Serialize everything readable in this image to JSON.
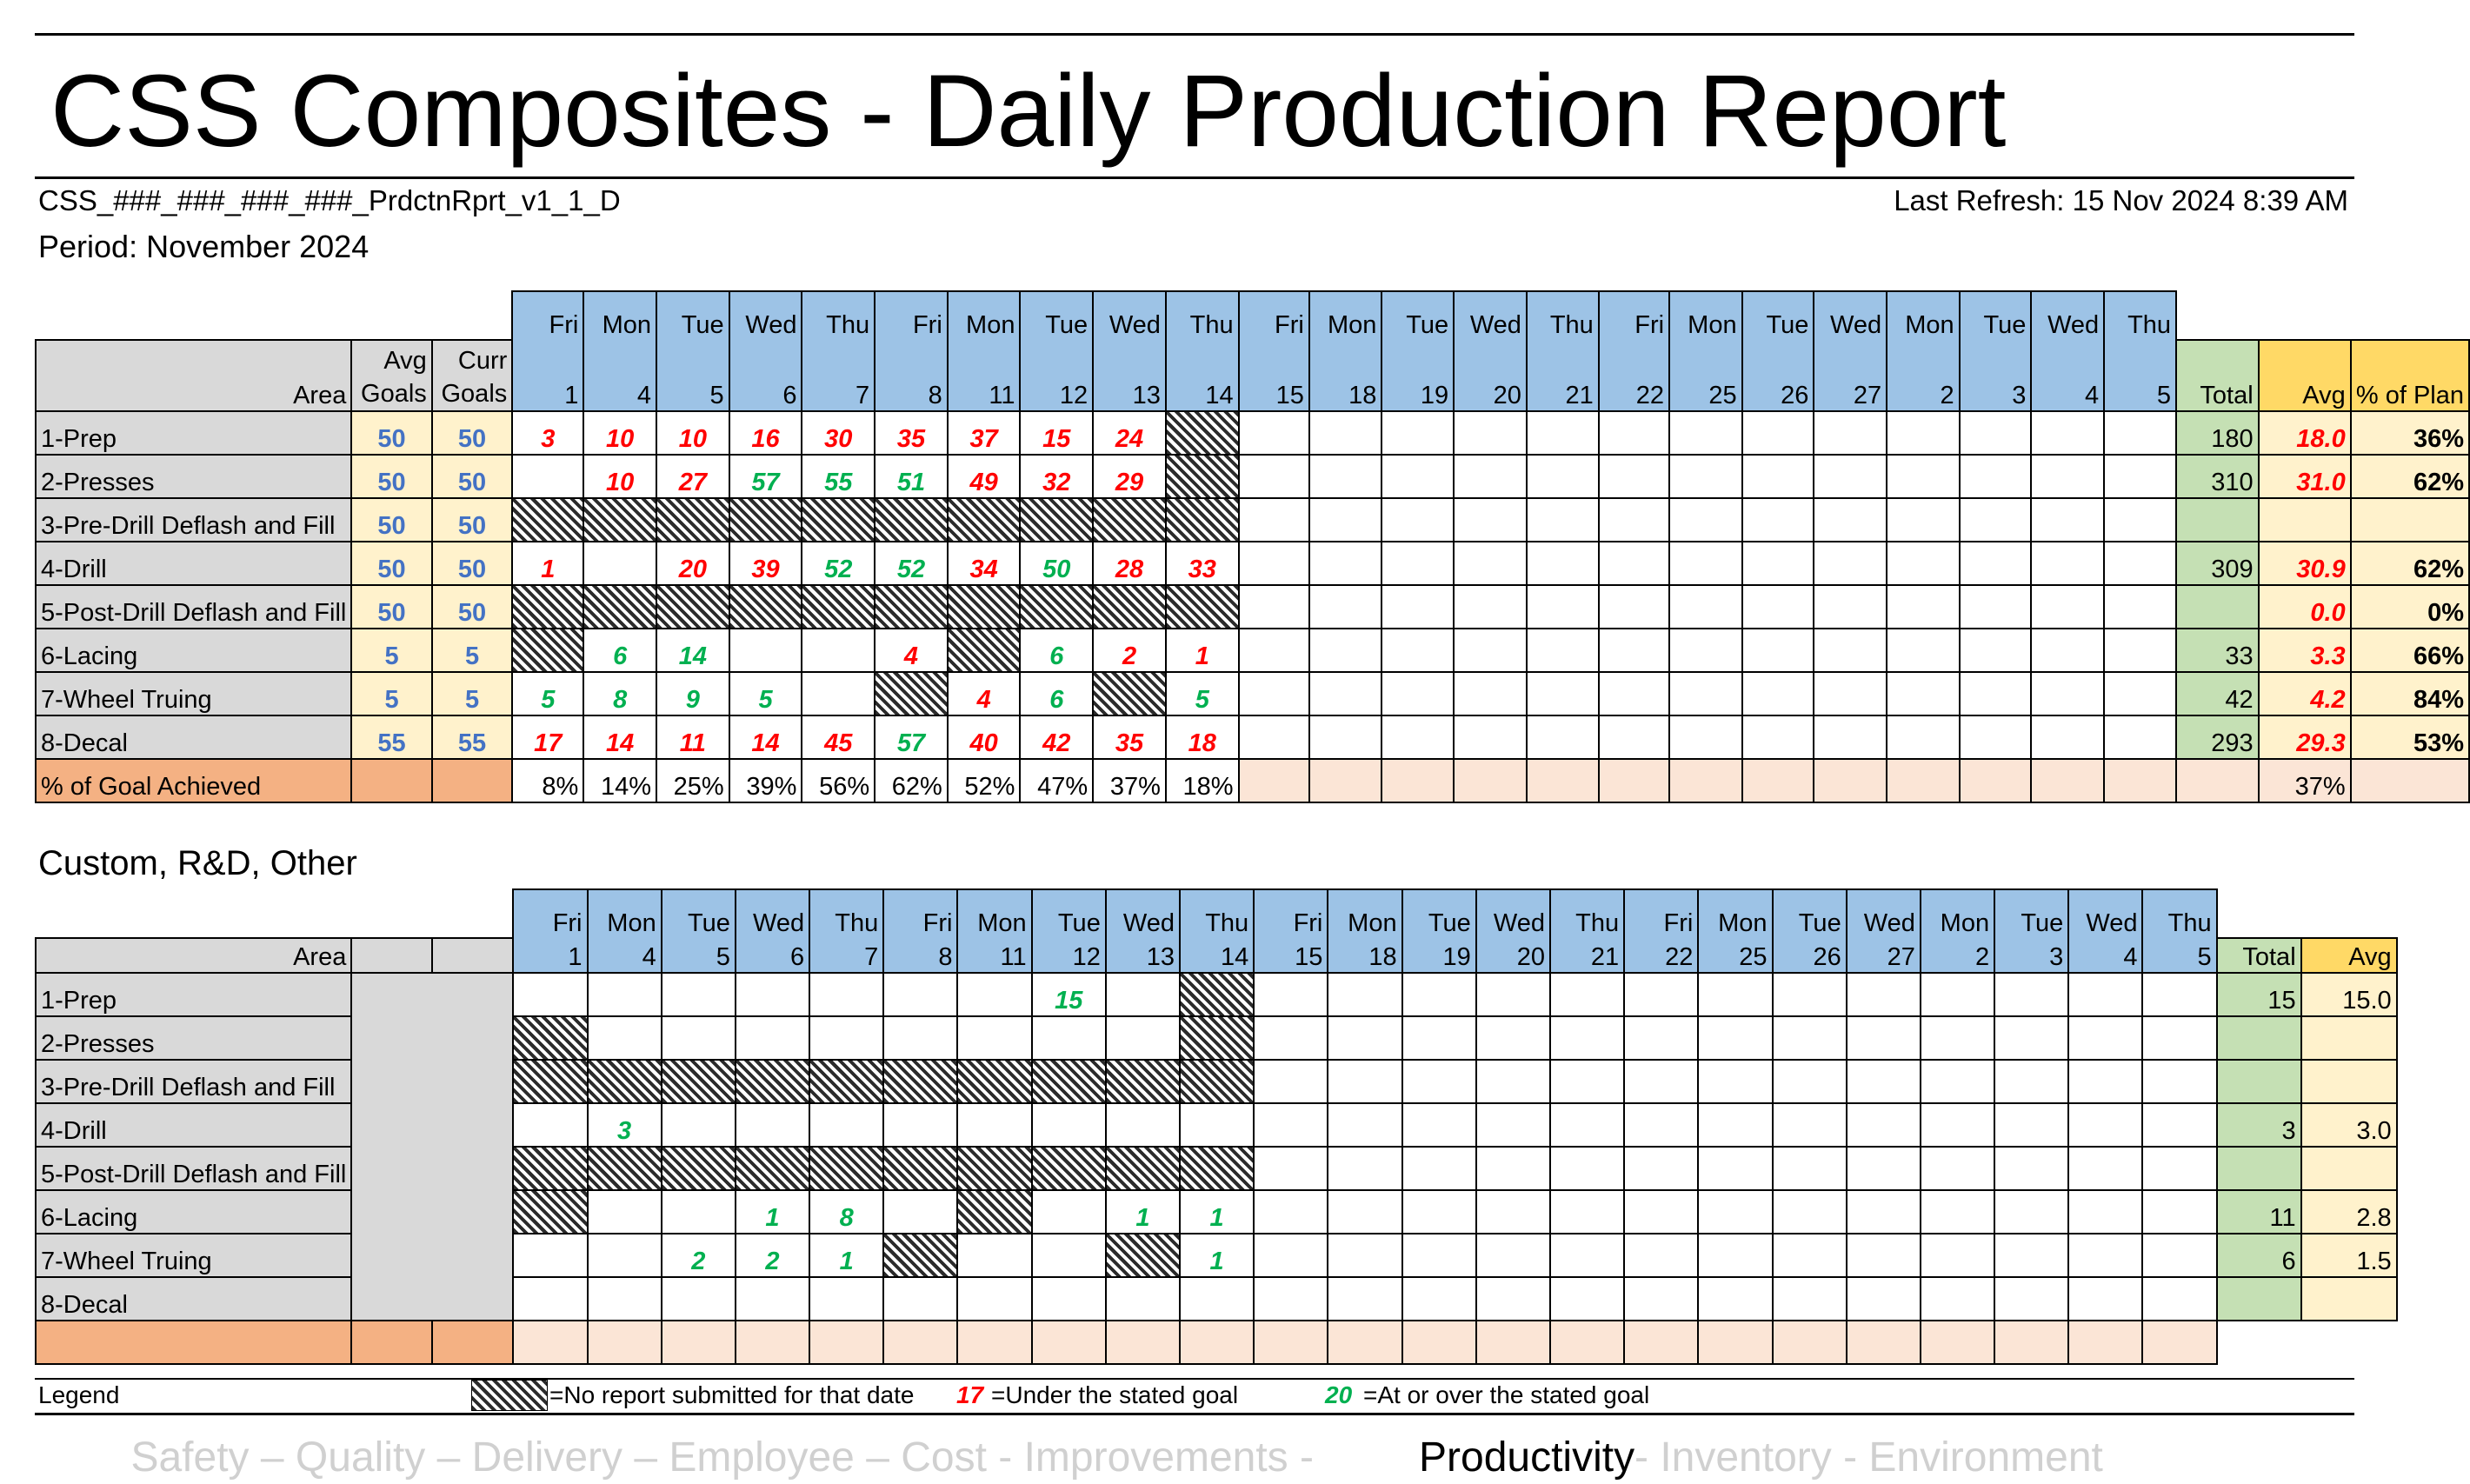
{
  "title": "CSS Composites - Daily Production Report",
  "file_name": "CSS_###_###_###_###_PrdctnRprt_v1_1_D",
  "last_refresh": "Last Refresh: 15 Nov 2024 8:39 AM",
  "period": "Period: November 2024",
  "days": [
    "Fri",
    "Mon",
    "Tue",
    "Wed",
    "Thu",
    "Fri",
    "Mon",
    "Tue",
    "Wed",
    "Thu",
    "Fri",
    "Mon",
    "Tue",
    "Wed",
    "Thu",
    "Fri",
    "Mon",
    "Tue",
    "Wed",
    "Mon",
    "Tue",
    "Wed",
    "Thu"
  ],
  "dates": [
    "1",
    "4",
    "5",
    "6",
    "7",
    "8",
    "11",
    "12",
    "13",
    "14",
    "15",
    "18",
    "19",
    "20",
    "21",
    "22",
    "25",
    "26",
    "27",
    "2",
    "3",
    "4",
    "5"
  ],
  "headers": {
    "area": "Area",
    "avg_goals": [
      "Avg",
      "Goals"
    ],
    "curr_goals": [
      "Curr",
      "Goals"
    ],
    "total": "Total",
    "avg": "Avg",
    "pct_plan": "% of Plan"
  },
  "colors": {
    "under_goal": "#ff0000",
    "at_goal": "#00b050",
    "goal_text": "#4472c4"
  },
  "main": {
    "rows": [
      {
        "area": "1-Prep",
        "avg_goal": "50",
        "curr_goal": "50",
        "cells": [
          [
            "3",
            "r"
          ],
          [
            "10",
            "r"
          ],
          [
            "10",
            "r"
          ],
          [
            "16",
            "r"
          ],
          [
            "30",
            "r"
          ],
          [
            "35",
            "r"
          ],
          [
            "37",
            "r"
          ],
          [
            "15",
            "r"
          ],
          [
            "24",
            "r"
          ],
          [
            "",
            "h"
          ]
        ],
        "total": "180",
        "avg": "18.0",
        "pct": "36%"
      },
      {
        "area": "2-Presses",
        "avg_goal": "50",
        "curr_goal": "50",
        "cells": [
          [
            "",
            ""
          ],
          [
            "10",
            "r"
          ],
          [
            "27",
            "r"
          ],
          [
            "57",
            "g"
          ],
          [
            "55",
            "g"
          ],
          [
            "51",
            "g"
          ],
          [
            "49",
            "r"
          ],
          [
            "32",
            "r"
          ],
          [
            "29",
            "r"
          ],
          [
            "",
            "h"
          ]
        ],
        "total": "310",
        "avg": "31.0",
        "pct": "62%"
      },
      {
        "area": "3-Pre-Drill Deflash and Fill",
        "avg_goal": "50",
        "curr_goal": "50",
        "cells": [
          [
            "",
            "h"
          ],
          [
            "",
            "h"
          ],
          [
            "",
            "h"
          ],
          [
            "",
            "h"
          ],
          [
            "",
            "h"
          ],
          [
            "",
            "h"
          ],
          [
            "",
            "h"
          ],
          [
            "",
            "h"
          ],
          [
            "",
            "h"
          ],
          [
            "",
            "h"
          ]
        ],
        "total": "",
        "avg": "",
        "pct": ""
      },
      {
        "area": "4-Drill",
        "avg_goal": "50",
        "curr_goal": "50",
        "cells": [
          [
            "1",
            "r"
          ],
          [
            "",
            ""
          ],
          [
            "20",
            "r"
          ],
          [
            "39",
            "r"
          ],
          [
            "52",
            "g"
          ],
          [
            "52",
            "g"
          ],
          [
            "34",
            "r"
          ],
          [
            "50",
            "g"
          ],
          [
            "28",
            "r"
          ],
          [
            "33",
            "r"
          ]
        ],
        "total": "309",
        "avg": "30.9",
        "pct": "62%"
      },
      {
        "area": "5-Post-Drill Deflash and Fill",
        "avg_goal": "50",
        "curr_goal": "50",
        "cells": [
          [
            "",
            "h"
          ],
          [
            "",
            "h"
          ],
          [
            "",
            "h"
          ],
          [
            "",
            "h"
          ],
          [
            "",
            "h"
          ],
          [
            "",
            "h"
          ],
          [
            "",
            "h"
          ],
          [
            "",
            "h"
          ],
          [
            "",
            "h"
          ],
          [
            "",
            "h"
          ]
        ],
        "total": "",
        "avg": "0.0",
        "pct": "0%"
      },
      {
        "area": "6-Lacing",
        "avg_goal": "5",
        "curr_goal": "5",
        "cells": [
          [
            "",
            "h"
          ],
          [
            "6",
            "g"
          ],
          [
            "14",
            "g"
          ],
          [
            "",
            ""
          ],
          [
            "",
            ""
          ],
          [
            "4",
            "r"
          ],
          [
            "",
            "h"
          ],
          [
            "6",
            "g"
          ],
          [
            "2",
            "r"
          ],
          [
            "1",
            "r"
          ]
        ],
        "total": "33",
        "avg": "3.3",
        "pct": "66%"
      },
      {
        "area": "7-Wheel Truing",
        "avg_goal": "5",
        "curr_goal": "5",
        "cells": [
          [
            "5",
            "g"
          ],
          [
            "8",
            "g"
          ],
          [
            "9",
            "g"
          ],
          [
            "5",
            "g"
          ],
          [
            "",
            ""
          ],
          [
            "",
            "h"
          ],
          [
            "4",
            "r"
          ],
          [
            "6",
            "g"
          ],
          [
            "",
            "h"
          ],
          [
            "5",
            "g"
          ]
        ],
        "total": "42",
        "avg": "4.2",
        "pct": "84%"
      },
      {
        "area": "8-Decal",
        "avg_goal": "55",
        "curr_goal": "55",
        "cells": [
          [
            "17",
            "r"
          ],
          [
            "14",
            "r"
          ],
          [
            "11",
            "r"
          ],
          [
            "14",
            "r"
          ],
          [
            "45",
            "r"
          ],
          [
            "57",
            "g"
          ],
          [
            "40",
            "r"
          ],
          [
            "42",
            "r"
          ],
          [
            "35",
            "r"
          ],
          [
            "18",
            "r"
          ]
        ],
        "total": "293",
        "avg": "29.3",
        "pct": "53%"
      }
    ],
    "goal_row": {
      "label": "% of Goal Achieved",
      "values": [
        "8%",
        "14%",
        "25%",
        "39%",
        "56%",
        "62%",
        "52%",
        "47%",
        "37%",
        "18%"
      ],
      "avg": "37%"
    }
  },
  "custom": {
    "title": "Custom, R&D, Other",
    "rows": [
      {
        "area": "1-Prep",
        "cells": [
          [
            "",
            ""
          ],
          [
            "",
            ""
          ],
          [
            "",
            ""
          ],
          [
            "",
            ""
          ],
          [
            "",
            ""
          ],
          [
            "",
            ""
          ],
          [
            "",
            ""
          ],
          [
            "15",
            "g"
          ],
          [
            "",
            ""
          ],
          [
            "",
            "h"
          ]
        ],
        "total": "15",
        "avg": "15.0"
      },
      {
        "area": "2-Presses",
        "cells": [
          [
            "",
            "h"
          ],
          [
            "",
            ""
          ],
          [
            "",
            ""
          ],
          [
            "",
            ""
          ],
          [
            "",
            ""
          ],
          [
            "",
            ""
          ],
          [
            "",
            ""
          ],
          [
            "",
            ""
          ],
          [
            "",
            ""
          ],
          [
            "",
            "h"
          ]
        ],
        "total": "",
        "avg": ""
      },
      {
        "area": "3-Pre-Drill Deflash and Fill",
        "cells": [
          [
            "",
            "h"
          ],
          [
            "",
            "h"
          ],
          [
            "",
            "h"
          ],
          [
            "",
            "h"
          ],
          [
            "",
            "h"
          ],
          [
            "",
            "h"
          ],
          [
            "",
            "h"
          ],
          [
            "",
            "h"
          ],
          [
            "",
            "h"
          ],
          [
            "",
            "h"
          ]
        ],
        "total": "",
        "avg": ""
      },
      {
        "area": "4-Drill",
        "cells": [
          [
            "",
            ""
          ],
          [
            "3",
            "g"
          ],
          [
            "",
            ""
          ],
          [
            "",
            ""
          ],
          [
            "",
            ""
          ],
          [
            "",
            ""
          ],
          [
            "",
            ""
          ],
          [
            "",
            ""
          ],
          [
            "",
            ""
          ],
          [
            "",
            ""
          ]
        ],
        "total": "3",
        "avg": "3.0"
      },
      {
        "area": "5-Post-Drill Deflash and Fill",
        "cells": [
          [
            "",
            "h"
          ],
          [
            "",
            "h"
          ],
          [
            "",
            "h"
          ],
          [
            "",
            "h"
          ],
          [
            "",
            "h"
          ],
          [
            "",
            "h"
          ],
          [
            "",
            "h"
          ],
          [
            "",
            "h"
          ],
          [
            "",
            "h"
          ],
          [
            "",
            "h"
          ]
        ],
        "total": "",
        "avg": ""
      },
      {
        "area": "6-Lacing",
        "cells": [
          [
            "",
            "h"
          ],
          [
            "",
            ""
          ],
          [
            "",
            ""
          ],
          [
            "1",
            "g"
          ],
          [
            "8",
            "g"
          ],
          [
            "",
            ""
          ],
          [
            "",
            "h"
          ],
          [
            "",
            ""
          ],
          [
            "1",
            "g"
          ],
          [
            "1",
            "g"
          ]
        ],
        "total": "11",
        "avg": "2.8"
      },
      {
        "area": "7-Wheel Truing",
        "cells": [
          [
            "",
            ""
          ],
          [
            "",
            ""
          ],
          [
            "2",
            "g"
          ],
          [
            "2",
            "g"
          ],
          [
            "1",
            "g"
          ],
          [
            "",
            "h"
          ],
          [
            "",
            ""
          ],
          [
            "",
            ""
          ],
          [
            "",
            "h"
          ],
          [
            "1",
            "g"
          ]
        ],
        "total": "6",
        "avg": "1.5"
      },
      {
        "area": "8-Decal",
        "cells": [
          [
            "",
            ""
          ],
          [
            "",
            ""
          ],
          [
            "",
            ""
          ],
          [
            "",
            ""
          ],
          [
            "",
            ""
          ],
          [
            "",
            ""
          ],
          [
            "",
            ""
          ],
          [
            "",
            ""
          ],
          [
            "",
            ""
          ],
          [
            "",
            ""
          ]
        ],
        "total": "",
        "avg": ""
      }
    ]
  },
  "legend": {
    "label": "Legend",
    "hatch_text": "=No report submitted for that date",
    "under_example": "17",
    "under_text": "=Under the stated goal",
    "at_example": "20",
    "at_text": "=At or over the stated goal"
  },
  "footer": {
    "before": "Safety – Quality – Delivery – Employee – Cost - Improvements - ",
    "highlight": "Productivity",
    "after": " - Inventory - Environment"
  }
}
